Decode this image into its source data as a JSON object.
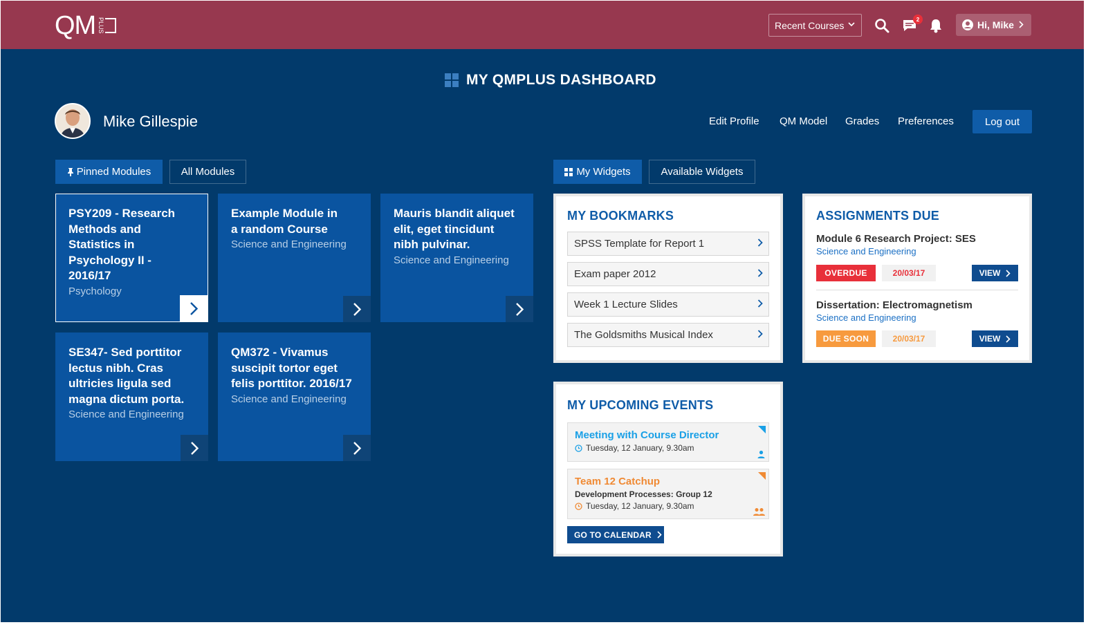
{
  "header": {
    "logo_text": "QM",
    "logo_plus": "PLUS",
    "recent_courses": "Recent Courses",
    "notifications_badge": "2",
    "greeting": "Hi, Mike"
  },
  "dashboard": {
    "title": "MY QMPLUS DASHBOARD"
  },
  "profile": {
    "name": "Mike Gillespie",
    "links": [
      "Edit Profile",
      "QM Model",
      "Grades",
      "Preferences"
    ],
    "logout": "Log out"
  },
  "module_tabs": {
    "pinned": "Pinned Modules",
    "all": "All Modules"
  },
  "widget_tabs": {
    "mine": "My Widgets",
    "available": "Available Widgets"
  },
  "modules": [
    {
      "title": "PSY209 - Research Methods and Statistics in Psychology II - 2016/17",
      "subtitle": "Psychology"
    },
    {
      "title": "Example Module in a random Course",
      "subtitle": "Science and Engineering"
    },
    {
      "title": "Mauris blandit aliquet elit, eget tincidunt nibh pulvinar.",
      "subtitle": "Science and Engineering"
    },
    {
      "title": "SE347- Sed porttitor lectus nibh. Cras ultricies ligula sed magna dictum porta.",
      "subtitle": "Science and Engineering"
    },
    {
      "title": "QM372 - Vivamus suscipit tortor eget felis porttitor. 2016/17",
      "subtitle": "Science and Engineering"
    }
  ],
  "bookmarks": {
    "title": "MY BOOKMARKS",
    "items": [
      "SPSS Template for Report 1",
      "Exam paper 2012",
      "Week 1 Lecture Slides",
      "The Goldsmiths Musical Index"
    ]
  },
  "assignments": {
    "title": "ASSIGNMENTS DUE",
    "items": [
      {
        "title": "Module 6 Research Project: SES",
        "subtitle": "Science and Engineering",
        "status": "OVERDUE",
        "date": "20/03/17",
        "action": "VIEW"
      },
      {
        "title": "Dissertation: Electromagnetism",
        "subtitle": "Science and Engineering",
        "status": "DUE SOON",
        "date": "20/03/17",
        "action": "VIEW"
      }
    ]
  },
  "events": {
    "title": "MY UPCOMING EVENTS",
    "items": [
      {
        "name": "Meeting with Course Director",
        "description": "",
        "time": "Tuesday, 12 January, 9.30am"
      },
      {
        "name": "Team 12 Catchup",
        "description": "Development Processes: Group 12",
        "time": "Tuesday, 12 January, 9.30am"
      }
    ],
    "go_to_calendar": "GO TO CALENDAR"
  },
  "colors": {
    "topbar": "#97384f",
    "background": "#023a6b",
    "module_tile": "#0a54a0",
    "accent_blue": "#0f5ca8",
    "overdue": "#e8303a",
    "due_soon": "#f79a3e",
    "event_blue": "#1aa0e6",
    "event_orange": "#f08a34"
  }
}
